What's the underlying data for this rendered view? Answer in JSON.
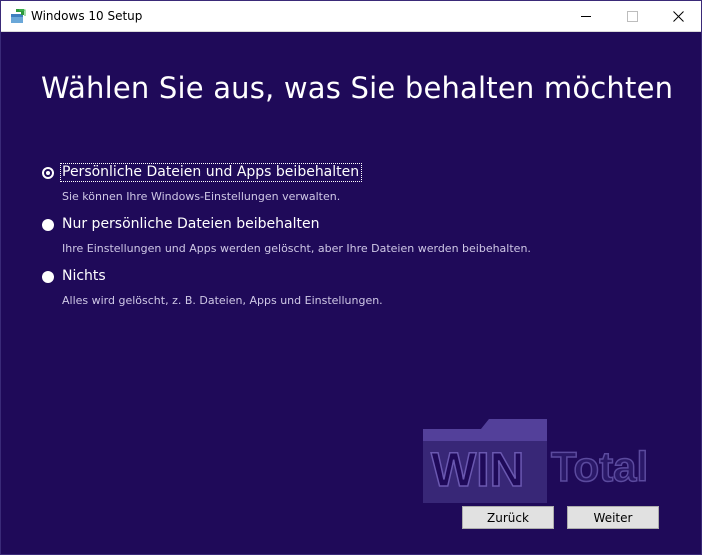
{
  "window": {
    "title": "Windows 10 Setup",
    "icon": "setup-box-icon"
  },
  "page": {
    "heading": "Wählen Sie aus, was Sie behalten möchten"
  },
  "options": [
    {
      "label": "Persönliche Dateien und Apps beibehalten",
      "description": "Sie können Ihre Windows-Einstellungen verwalten.",
      "selected": true
    },
    {
      "label": "Nur persönliche Dateien beibehalten",
      "description": "Ihre Einstellungen und Apps werden gelöscht, aber Ihre Dateien werden beibehalten.",
      "selected": false
    },
    {
      "label": "Nichts",
      "description": "Alles wird gelöscht, z. B. Dateien, Apps und Einstellungen.",
      "selected": false
    }
  ],
  "buttons": {
    "back_label": "Zurück",
    "next_label": "Weiter"
  },
  "watermark": {
    "text_left": "WIN",
    "text_right": "Total"
  },
  "colors": {
    "background": "#1f0a59",
    "text": "#ffffff",
    "button_face": "#e1e1e1"
  }
}
